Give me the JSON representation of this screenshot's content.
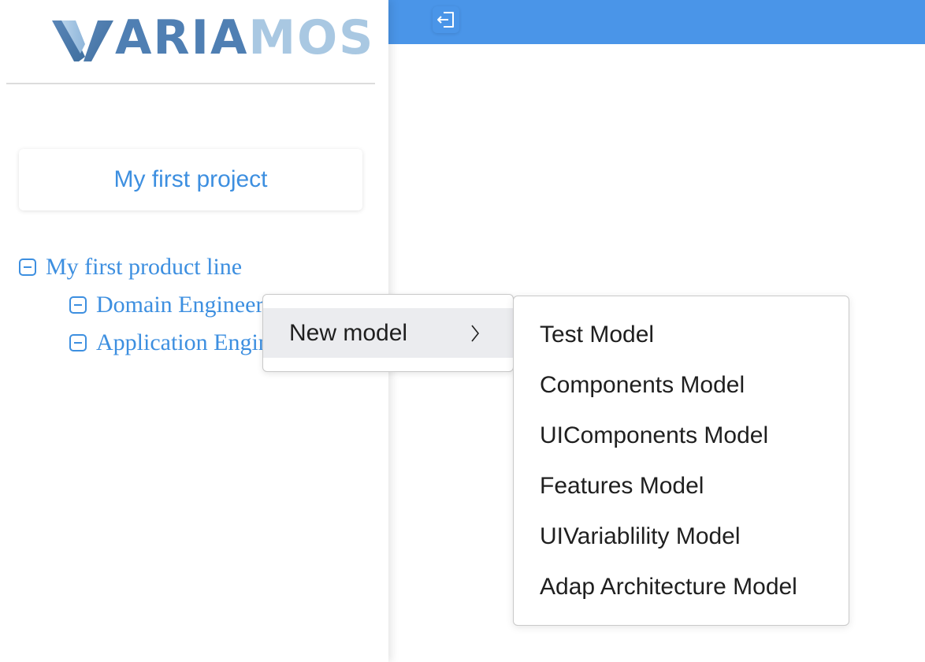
{
  "logo": {
    "v_letter": "V",
    "dark_text": "ARIA",
    "light_text": "MOS"
  },
  "topbar": {
    "back_icon": "exit-icon",
    "color": "#4a95e8"
  },
  "project": {
    "title": "My first project"
  },
  "tree": {
    "root": {
      "label": "My first product line",
      "icon": "minus-square-icon"
    },
    "children": [
      {
        "label": "Domain Engineering",
        "icon": "minus-square-icon"
      },
      {
        "label": "Application Engineering",
        "icon": "minus-square-icon"
      }
    ]
  },
  "context_menu": {
    "item": "New model",
    "chevron_icon": "chevron-right-icon"
  },
  "submenu": {
    "items": [
      "Test Model",
      "Components Model",
      "UIComponents Model",
      "Features Model",
      "UIVariablility Model",
      "Adap Architecture Model"
    ]
  },
  "colors": {
    "accent": "#3d8fe0",
    "topbar": "#4a95e8",
    "menu_highlight": "#ebecef"
  }
}
